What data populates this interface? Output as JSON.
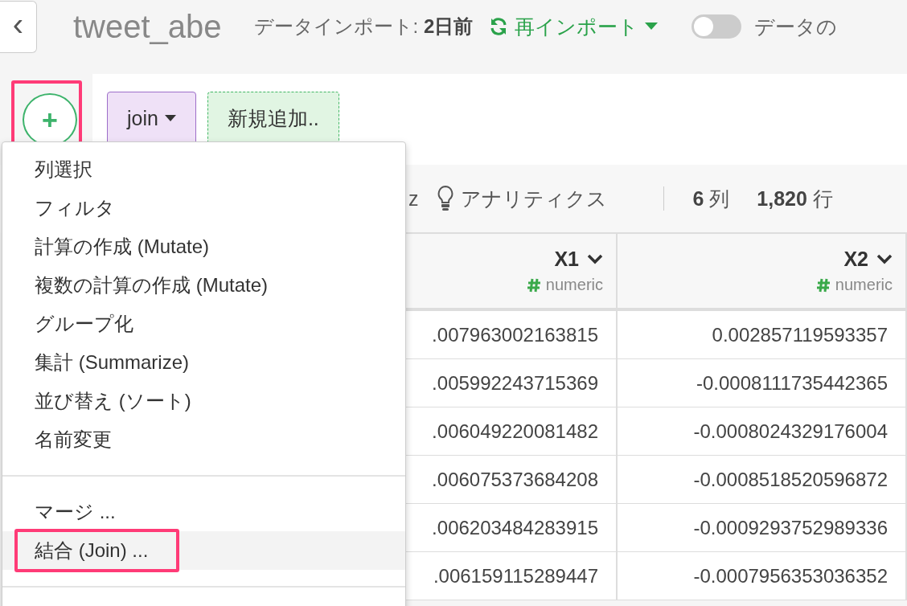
{
  "header": {
    "back_icon": "‹",
    "title": "tweet_abe",
    "import_label": "データインポート: ",
    "import_age": "2日前",
    "reimport": "再インポート",
    "toggle": {
      "on": false
    },
    "toggle_label": "データの"
  },
  "add_button": {
    "symbol": "+",
    "outlined": true
  },
  "steps": [
    {
      "kind": "step",
      "label": "join"
    },
    {
      "kind": "new",
      "label": "新規追加.."
    }
  ],
  "toolbar": {
    "cut_text": "z",
    "analytics": "アナリティクス",
    "columns_count": "6",
    "columns_unit": "列",
    "rows_count": "1,820",
    "rows_unit": "行"
  },
  "table": {
    "columns": [
      {
        "name": "X1",
        "type": "numeric"
      },
      {
        "name": "X2",
        "type": "numeric"
      }
    ],
    "rows": [
      [
        ".007963002163815",
        "0.002857119593357"
      ],
      [
        ".005992243715369",
        "-0.0008111735442365"
      ],
      [
        ".006049220081482",
        "-0.0008024329176004"
      ],
      [
        ".006075373684208",
        "-0.0008518520596872"
      ],
      [
        ".006203484283915",
        "-0.0009293752989336"
      ],
      [
        ".006159115289447",
        "-0.0007956353036352"
      ]
    ]
  },
  "menu": {
    "groups": [
      [
        {
          "label": "列選択",
          "selected": false,
          "outlined": false
        },
        {
          "label": "フィルタ",
          "selected": false,
          "outlined": false
        },
        {
          "label": "計算の作成 (Mutate)",
          "selected": false,
          "outlined": false
        },
        {
          "label": "複数の計算の作成 (Mutate)",
          "selected": false,
          "outlined": false
        },
        {
          "label": "グループ化",
          "selected": false,
          "outlined": false
        },
        {
          "label": "集計 (Summarize)",
          "selected": false,
          "outlined": false
        },
        {
          "label": "並び替え (ソート)",
          "selected": false,
          "outlined": false
        },
        {
          "label": "名前変更",
          "selected": false,
          "outlined": false
        }
      ],
      [
        {
          "label": "マージ ...",
          "selected": false,
          "outlined": false
        },
        {
          "label": "結合 (Join) ...",
          "selected": true,
          "outlined": true
        }
      ]
    ]
  }
}
